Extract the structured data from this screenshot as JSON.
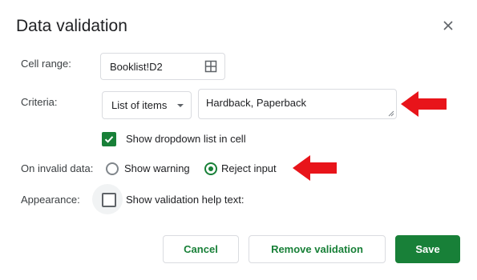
{
  "dialog": {
    "title": "Data validation",
    "close_icon": "close-icon"
  },
  "cell_range": {
    "label": "Cell range:",
    "value": "Booklist!D2",
    "icon": "grid-icon"
  },
  "criteria": {
    "label": "Criteria:",
    "type": "List of items",
    "items_value": "Hardback, Paperback"
  },
  "dropdown": {
    "label": "Show dropdown list in cell",
    "checked": true
  },
  "invalid_data": {
    "label": "On invalid data:",
    "options": [
      {
        "label": "Show warning",
        "selected": false
      },
      {
        "label": "Reject input",
        "selected": true
      }
    ]
  },
  "appearance": {
    "label": "Appearance:",
    "help_text_label": "Show validation help text:",
    "checked": false
  },
  "buttons": {
    "cancel": "Cancel",
    "remove": "Remove validation",
    "save": "Save"
  },
  "colors": {
    "accent": "#188038",
    "annotation_arrow": "#e8141a"
  }
}
